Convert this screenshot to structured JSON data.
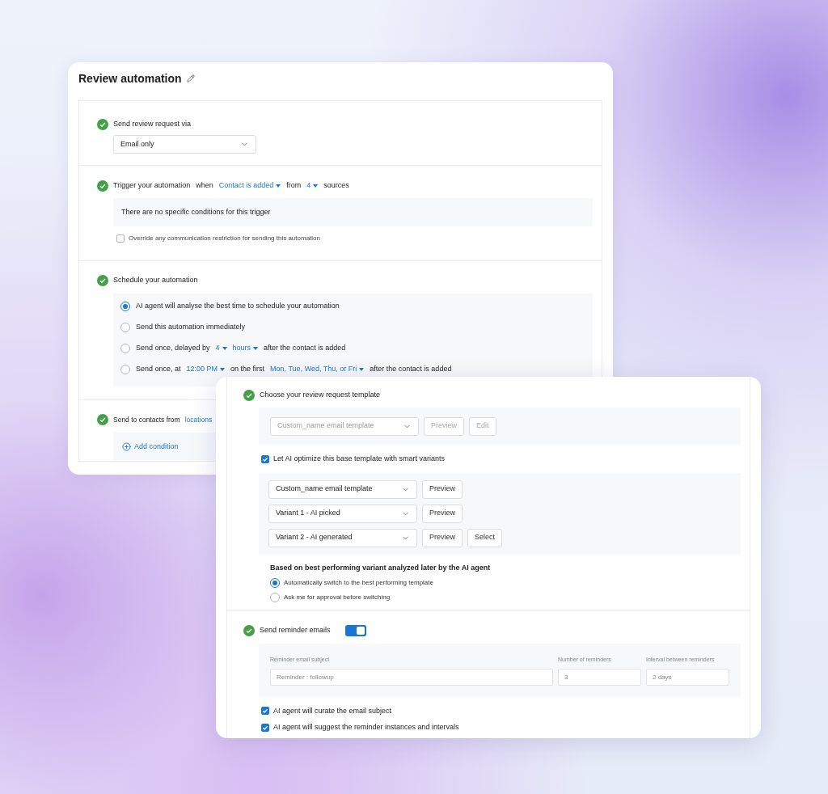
{
  "back_card": {
    "title": "Review automation",
    "via": {
      "done": true,
      "label": "Send review request via",
      "select": "Email only"
    },
    "trigger": {
      "done": true,
      "parts": [
        {
          "kind": "text",
          "text": "Trigger your automation"
        },
        {
          "kind": "text",
          "text": "when"
        },
        {
          "kind": "dropdown",
          "text": "Contact is added"
        },
        {
          "kind": "text",
          "text": "from"
        },
        {
          "kind": "dropdown",
          "text": "4"
        },
        {
          "kind": "text",
          "text": "sources"
        }
      ],
      "note": "There are no specific conditions for this trigger",
      "override": {
        "label": "Override any communication restriction for sending this automation",
        "checked": false
      }
    },
    "schedule": {
      "done": true,
      "label": "Schedule your automation",
      "options": [
        {
          "selected": true,
          "parts": [
            {
              "kind": "text",
              "text": "AI agent will analyse the best time to schedule your automation"
            }
          ]
        },
        {
          "selected": false,
          "parts": [
            {
              "kind": "text",
              "text": "Send this automation immediately"
            }
          ]
        },
        {
          "selected": false,
          "parts": [
            {
              "kind": "text",
              "text": "Send once, delayed by"
            },
            {
              "kind": "dropdown",
              "text": "4"
            },
            {
              "kind": "dropdown",
              "text": "hours"
            },
            {
              "kind": "text",
              "text": "after the contact is added"
            }
          ]
        },
        {
          "selected": false,
          "parts": [
            {
              "kind": "text",
              "text": "Send once, at"
            },
            {
              "kind": "dropdown",
              "text": "12:00 PM"
            },
            {
              "kind": "text",
              "text": "on the first"
            },
            {
              "kind": "dropdown",
              "text": "Mon, Tue, Wed, Thu, or Fri"
            },
            {
              "kind": "text",
              "text": "after the contact is added"
            }
          ]
        }
      ]
    },
    "contacts": {
      "done": true,
      "label": "Send to contacts from",
      "link": "locations",
      "add_condition": "Add condition"
    }
  },
  "front_card": {
    "template": {
      "done": true,
      "label": "Choose your review request template",
      "base": {
        "select": "Custom_name email template",
        "disabled": true,
        "buttons": [
          "Preview",
          "Edit"
        ]
      },
      "optimize": {
        "label": "Let AI optimize this base template with smart variants",
        "checked": true
      },
      "variants": [
        {
          "select": "Custom_name email template",
          "buttons": [
            "Preview"
          ]
        },
        {
          "select": "Variant 1  - AI picked",
          "buttons": [
            "Preview"
          ]
        },
        {
          "select": "Variant 2 - AI generated",
          "buttons": [
            "Preview",
            "Select"
          ]
        }
      ],
      "based_on": "Based on best performing variant analyzed later by the AI agent",
      "options": [
        {
          "label": "Automatically switch to the best performing template",
          "selected": true
        },
        {
          "label": "Ask me for approval before switching",
          "selected": false
        }
      ]
    },
    "reminders": {
      "done": true,
      "label": "Send reminder emails",
      "on": true,
      "fields": [
        {
          "label": "Reminder email subject",
          "value": "Reminder : followup"
        },
        {
          "label": "Number of reminders",
          "value": "3"
        },
        {
          "label": "Interval between reminders",
          "value": "2 days"
        }
      ],
      "checks": [
        {
          "label": "AI agent will curate the email subject",
          "checked": true
        },
        {
          "label": "AI agent will suggest the reminder instances and intervals",
          "checked": true
        }
      ]
    }
  }
}
